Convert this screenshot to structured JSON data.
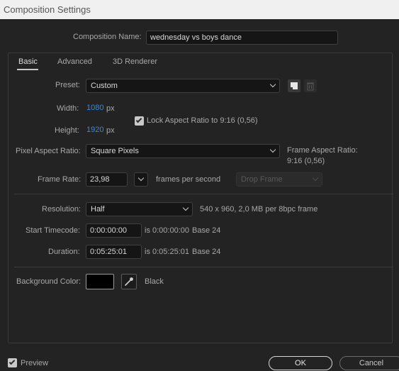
{
  "window": {
    "title": "Composition Settings"
  },
  "composition_name": {
    "label": "Composition Name:",
    "value": "wednesday vs boys dance"
  },
  "tabs": [
    {
      "label": "Basic",
      "active": true
    },
    {
      "label": "Advanced",
      "active": false
    },
    {
      "label": "3D Renderer",
      "active": false
    }
  ],
  "preset": {
    "label": "Preset:",
    "value": "Custom"
  },
  "width": {
    "label": "Width:",
    "value": "1080",
    "unit": "px"
  },
  "height": {
    "label": "Height:",
    "value": "1920",
    "unit": "px"
  },
  "lock_aspect": {
    "label": "Lock Aspect Ratio to 9:16 (0,56)",
    "checked": true
  },
  "pixel_aspect": {
    "label": "Pixel Aspect Ratio:",
    "value": "Square Pixels"
  },
  "frame_aspect": {
    "label": "Frame Aspect Ratio:",
    "value": "9:16 (0,56)"
  },
  "frame_rate": {
    "label": "Frame Rate:",
    "value": "23,98",
    "unit": "frames per second",
    "drop_frame": "Drop Frame"
  },
  "resolution": {
    "label": "Resolution:",
    "value": "Half",
    "info": "540 x 960, 2,0 MB per 8bpc frame"
  },
  "start_timecode": {
    "label": "Start Timecode:",
    "value": "0:00:00:00",
    "is_text": "is 0:00:00:00",
    "base": "Base 24"
  },
  "duration": {
    "label": "Duration:",
    "value": "0:05:25:01",
    "is_text": "is 0:05:25:01",
    "base": "Base 24"
  },
  "background": {
    "label": "Background Color:",
    "color_name": "Black",
    "color": "#000000"
  },
  "footer": {
    "preview_label": "Preview",
    "preview_checked": true,
    "ok_label": "OK",
    "cancel_label": "Cancel"
  },
  "colors": {
    "accent_blue": "#2d8ceb",
    "dialog_bg": "#232323",
    "field_bg": "#151515"
  }
}
